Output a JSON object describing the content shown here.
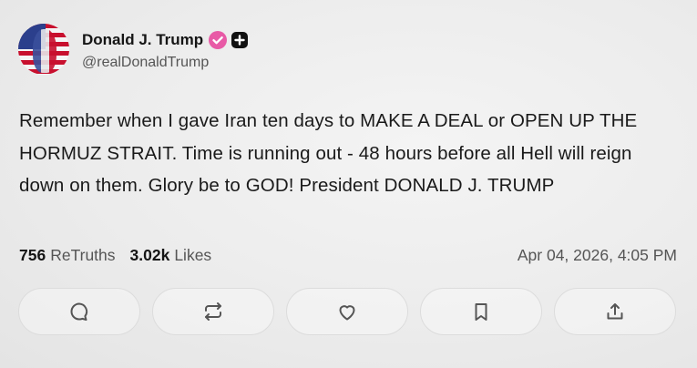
{
  "author": {
    "display_name": "Donald J. Trump",
    "handle": "@realDonaldTrump"
  },
  "post": {
    "text": "Remember when I gave Iran ten days to MAKE A DEAL or OPEN UP THE HORMUZ STRAIT. Time is running out - 48 hours before all Hell will reign down on them. Glory be to GOD! President DONALD J. TRUMP"
  },
  "stats": {
    "retruths_count": "756",
    "retruths_label": "ReTruths",
    "likes_count": "3.02k",
    "likes_label": "Likes",
    "timestamp": "Apr 04, 2026, 4:05 PM"
  },
  "actions": [
    {
      "icon": "reply-icon"
    },
    {
      "icon": "retruth-icon"
    },
    {
      "icon": "like-icon"
    },
    {
      "icon": "bookmark-icon"
    },
    {
      "icon": "share-icon"
    }
  ],
  "colors": {
    "verified_badge": "#e85aa6",
    "text_primary": "#151515",
    "text_secondary": "#555555",
    "icon": "#555555"
  }
}
